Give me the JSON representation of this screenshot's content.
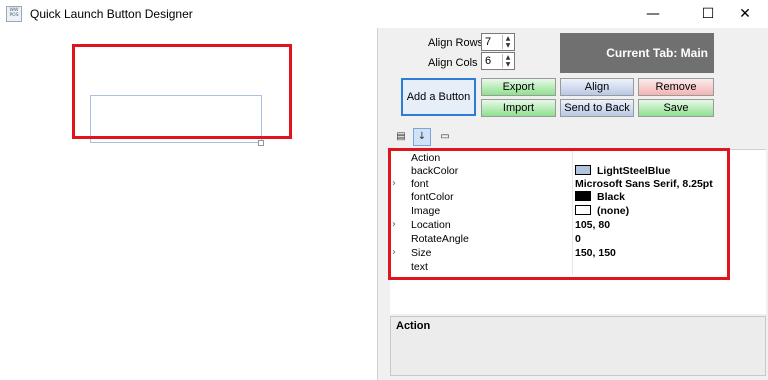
{
  "window": {
    "title": "Quick Launch Button Designer",
    "icon_text": "WW POS",
    "minimize": "—",
    "maximize": "☐",
    "close": "✕"
  },
  "align": {
    "rows_label": "Align Rows",
    "rows_value": "7",
    "cols_label": "Align Cols",
    "cols_value": "6"
  },
  "current_tab": "Current Tab: Main",
  "buttons": {
    "add": "Add a Button",
    "export": "Export",
    "import": "Import",
    "align": "Align",
    "send_to_back": "Send to Back",
    "remove": "Remove",
    "save": "Save"
  },
  "properties": [
    {
      "name": "Action",
      "value": "",
      "expandable": false
    },
    {
      "name": "backColor",
      "value": "LightSteelBlue",
      "swatch": "#b0c4de",
      "expandable": false
    },
    {
      "name": "font",
      "value": "Microsoft Sans Serif, 8.25pt",
      "expandable": true
    },
    {
      "name": "fontColor",
      "value": "Black",
      "swatch": "#000000",
      "expandable": false
    },
    {
      "name": "Image",
      "value": "(none)",
      "swatch": "#ffffff",
      "expandable": false
    },
    {
      "name": "Location",
      "value": "105, 80",
      "expandable": true
    },
    {
      "name": "RotateAngle",
      "value": "0",
      "expandable": false
    },
    {
      "name": "Size",
      "value": "150, 150",
      "expandable": true
    },
    {
      "name": "text",
      "value": "",
      "expandable": false
    }
  ],
  "description": {
    "title": "Action"
  },
  "colors": {
    "highlight_red": "#e0141c",
    "current_tab_bg": "#707070",
    "add_button_border": "#2f7bd6"
  }
}
